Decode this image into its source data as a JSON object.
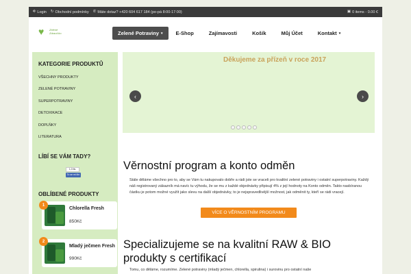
{
  "topbar": {
    "login": "Login",
    "terms": "Obchodní podmínky",
    "phone": "Máte dotaz? +420 604 617 184 (po-pá 8:00-17:00)",
    "cart": "0 items - 0.00 €",
    "icons": {
      "login": "login-icon",
      "terms": "refresh-icon",
      "phone": "phone-icon",
      "cart": "cart-icon"
    }
  },
  "logo": {
    "line1": "Zelené",
    "line2": "Zdravíčko"
  },
  "nav": {
    "items": [
      {
        "label": "Zelené Potraviny",
        "active": true,
        "caret": true
      },
      {
        "label": "E-Shop",
        "active": false,
        "caret": false
      },
      {
        "label": "Zajímavosti",
        "active": false,
        "caret": false
      },
      {
        "label": "Košík",
        "active": false,
        "caret": false
      },
      {
        "label": "Můj Účet",
        "active": false,
        "caret": false
      },
      {
        "label": "Kontakt",
        "active": false,
        "caret": true
      }
    ]
  },
  "sidebar": {
    "categories_title": "KATEGORIE PRODUKTŮ",
    "categories": [
      "VŠECHNY PRODUKTY",
      "ZELENÉ POTRAVINY",
      "SUPERPOTRAVINY",
      "DETOXIKACE",
      "DOPLŇKY",
      "LITERATURA"
    ],
    "like_title": "LÍBÍ SE VÁM TADY?",
    "fb_count": "1,3 tis.",
    "fb_like": "To se mi líbí",
    "favorites_title": "OBLÍBENÉ PRODUKTY",
    "products": [
      {
        "rank": "1",
        "name": "Chlorella Fresh",
        "price": "850Kč"
      },
      {
        "rank": "2",
        "name": "Mladý ječmen Fresh",
        "price": "990Kč"
      }
    ]
  },
  "slider": {
    "title": "Děkujeme za přízeň v roce 2017",
    "prev": "‹",
    "next": "›",
    "dots": 5
  },
  "section1": {
    "title": "Věrnostní program a konto odměn",
    "text": "Stále děláme všechno pro to, aby se Vám tu nakupovalo dobře a rádi jste se vraceli pro kvalitní zelené potraviny i ostatní superpotraviny. Každý náš registrovaný zákazník má navíc tu výhodu, že se mu z každé objednávky připisují 4% z její hodnoty na Konto odměn. Takto nasbíranou částku je potom možné využít jako slevu na další objednávky, to je nejspravedlivější možnost, jak odměnit ty, kteří se rádi vracejí.",
    "cta": "VÍCE O VĚRNOSTNÍM PROGRAMU"
  },
  "section2": {
    "title": "Specializujeme se na kvalitní RAW & BIO produkty s certifikací",
    "text": "Tomu, co děláme, rozumíme. Zelené potraviny (mladý ječmen, chlorella, spirulina) i surovinu pro ostatní naše"
  },
  "colors": {
    "accent": "#f28a1b",
    "sidebar_bg": "#d6ecc1",
    "slider_bg": "#e4f4d4",
    "nav_active": "#4d4d4d",
    "topbar": "#3a3a3a",
    "slide_title": "#c9a25a"
  }
}
